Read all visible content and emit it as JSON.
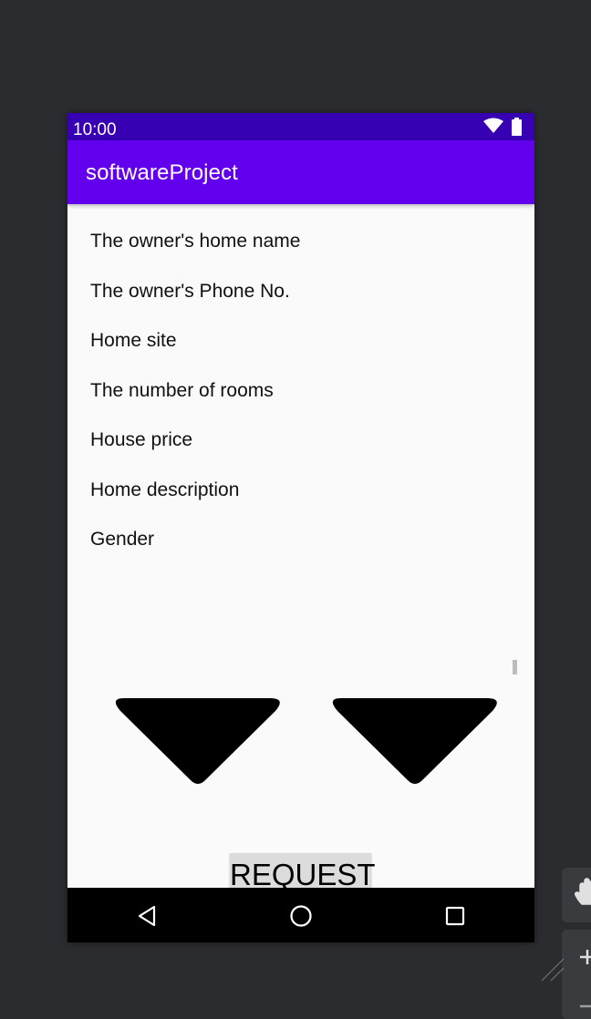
{
  "status_bar": {
    "time": "10:00",
    "icons": [
      "wifi-icon",
      "battery-icon"
    ],
    "color": "#3700b3"
  },
  "app_bar": {
    "title": "softwareProject",
    "color": "#6200ee"
  },
  "form": {
    "labels": [
      "The owner's home name",
      "The owner's Phone No.",
      "Home site",
      "The number of rooms",
      "House price",
      "Home description",
      "Gender"
    ]
  },
  "spinners": [
    {
      "icon": "dropdown-triangle-icon"
    },
    {
      "icon": "dropdown-triangle-icon"
    }
  ],
  "request_button": {
    "label": "REQUEST"
  },
  "nav_bar": {
    "buttons": [
      "back-icon",
      "home-icon",
      "recents-icon"
    ]
  },
  "emulator_toolbar": {
    "icons": [
      "hand-icon",
      "zoom-in-icon",
      "zoom-out-icon"
    ]
  }
}
